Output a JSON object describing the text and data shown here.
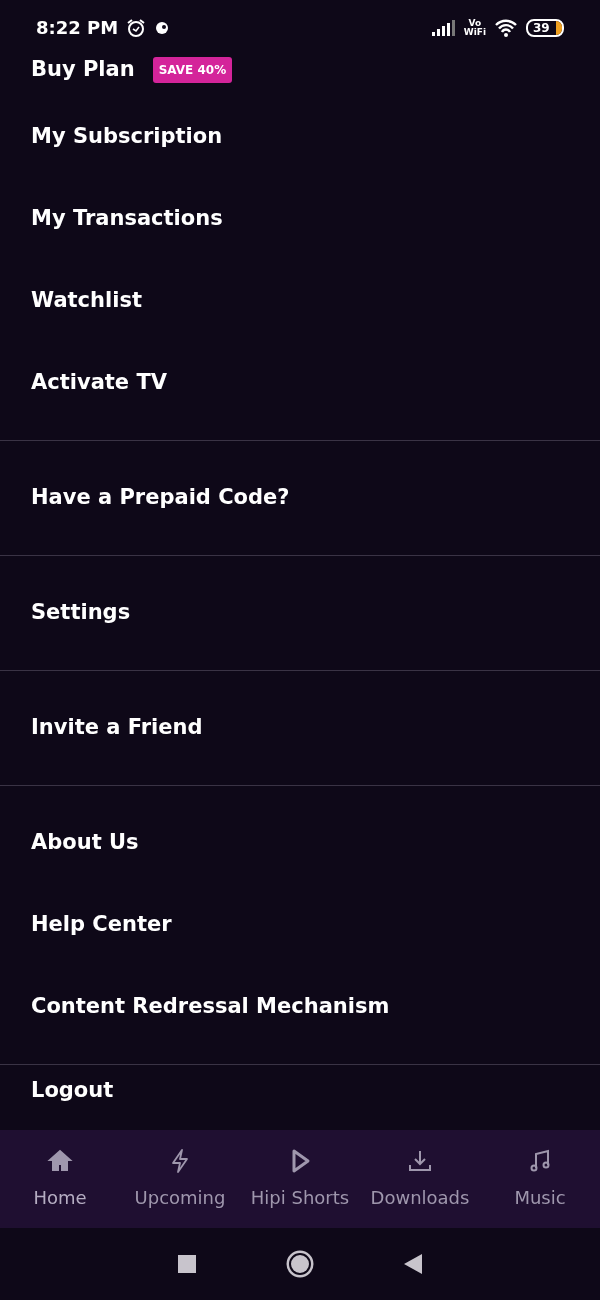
{
  "status_bar": {
    "time": "8:22 PM",
    "network": "Vo\nWiFi",
    "battery": "39"
  },
  "menu_sections": [
    {
      "items": [
        {
          "label": "Buy Plan",
          "badge": "SAVE 40%"
        },
        {
          "label": "My Subscription"
        },
        {
          "label": "My Transactions"
        },
        {
          "label": "Watchlist"
        },
        {
          "label": "Activate TV"
        }
      ]
    },
    {
      "items": [
        {
          "label": "Have a Prepaid Code?"
        }
      ]
    },
    {
      "items": [
        {
          "label": "Settings"
        }
      ]
    },
    {
      "items": [
        {
          "label": "Invite a Friend"
        }
      ]
    },
    {
      "items": [
        {
          "label": "About Us"
        },
        {
          "label": "Help Center"
        },
        {
          "label": "Content Redressal Mechanism"
        }
      ]
    },
    {
      "items": [
        {
          "label": "Logout"
        }
      ]
    }
  ],
  "bottom_nav": [
    {
      "label": "Home",
      "kind": "home",
      "selected": true
    },
    {
      "label": "Upcoming",
      "kind": "bolt",
      "selected": false
    },
    {
      "label": "Hipi Shorts",
      "kind": "play",
      "selected": false
    },
    {
      "label": "Downloads",
      "kind": "download",
      "selected": false
    },
    {
      "label": "Music",
      "kind": "music",
      "selected": false
    }
  ]
}
